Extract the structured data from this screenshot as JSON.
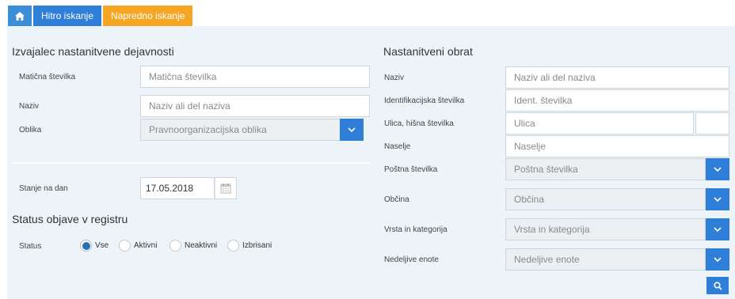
{
  "tabs": {
    "quick": "Hitro iskanje",
    "advanced": "Napredno iskanje"
  },
  "left": {
    "title": "Izvajalec nastanitvene dejavnosti",
    "fields": {
      "maticna": {
        "label": "Matična številka",
        "placeholder": "Matična številka"
      },
      "naziv": {
        "label": "Naziv",
        "placeholder": "Naziv ali del naziva"
      },
      "oblika": {
        "label": "Oblika",
        "placeholder": "Pravnoorganizacijska oblika"
      }
    },
    "stanje": {
      "label": "Stanje na dan",
      "value": "17.05.2018"
    },
    "status_title": "Status objave v registru",
    "status": {
      "label": "Status",
      "options": [
        "Vse",
        "Aktivni",
        "Neaktivni",
        "Izbrisani"
      ],
      "selected": "Vse"
    }
  },
  "right": {
    "title": "Nastanitveni obrat",
    "fields": {
      "naziv": {
        "label": "Naziv",
        "placeholder": "Naziv ali del naziva"
      },
      "ident": {
        "label": "Identifikacijska številka",
        "placeholder": "Ident. številka"
      },
      "ulica": {
        "label": "Ulica, hišna številka",
        "placeholder": "Ulica"
      },
      "naselje": {
        "label": "Naselje",
        "placeholder": "Naselje"
      },
      "posta": {
        "label": "Poštna številka",
        "placeholder": "Poštna številka"
      },
      "obcina": {
        "label": "Občina",
        "placeholder": "Občina"
      },
      "vrsta": {
        "label": "Vrsta in kategorija",
        "placeholder": "Vrsta in kategorija"
      },
      "nedeljive": {
        "label": "Nedeljive enote",
        "placeholder": "Nedeljive enote"
      }
    }
  },
  "icons": {
    "home": "home-icon",
    "dropdown": "chevron-down-icon",
    "calendar": "calendar-icon",
    "search": "search-icon"
  },
  "colors": {
    "primary": "#2f7ed8",
    "accent": "#f5a623",
    "panel": "#edf4f9"
  }
}
